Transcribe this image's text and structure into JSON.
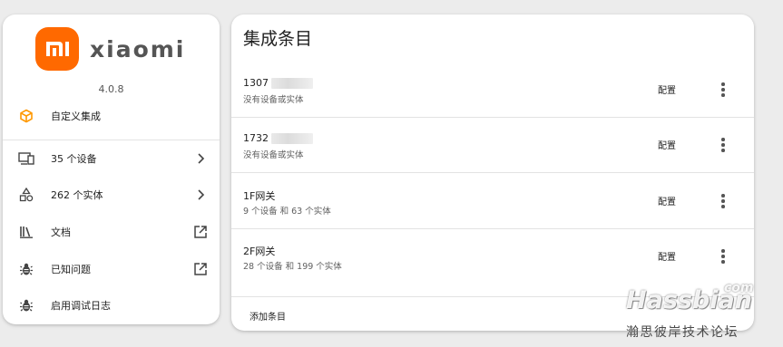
{
  "sidebar": {
    "brand": "xiaomi",
    "version": "4.0.8",
    "custom_integration": "自定义集成",
    "items": [
      {
        "label": "35 个设备"
      },
      {
        "label": "262 个实体"
      },
      {
        "label": "文档"
      },
      {
        "label": "已知问题"
      },
      {
        "label": "启用调试日志"
      }
    ]
  },
  "main": {
    "title": "集成条目",
    "entries": [
      {
        "name": "1307",
        "desc": "没有设备或实体",
        "configure": "配置"
      },
      {
        "name": "1732",
        "desc": "没有设备或实体",
        "configure": "配置"
      },
      {
        "name": "1F网关",
        "desc": "9 个设备 和 63 个实体",
        "configure": "配置"
      },
      {
        "name": "2F网关",
        "desc": "28 个设备 和 199 个实体",
        "configure": "配置"
      }
    ],
    "add_entry": "添加条目"
  },
  "watermark": {
    "main": "Hassbian",
    "com": "com",
    "sub": "瀚思彼岸技术论坛"
  },
  "colors": {
    "accent": "#ff6900",
    "custom_icon": "#ff9800",
    "background": "#ececec"
  }
}
